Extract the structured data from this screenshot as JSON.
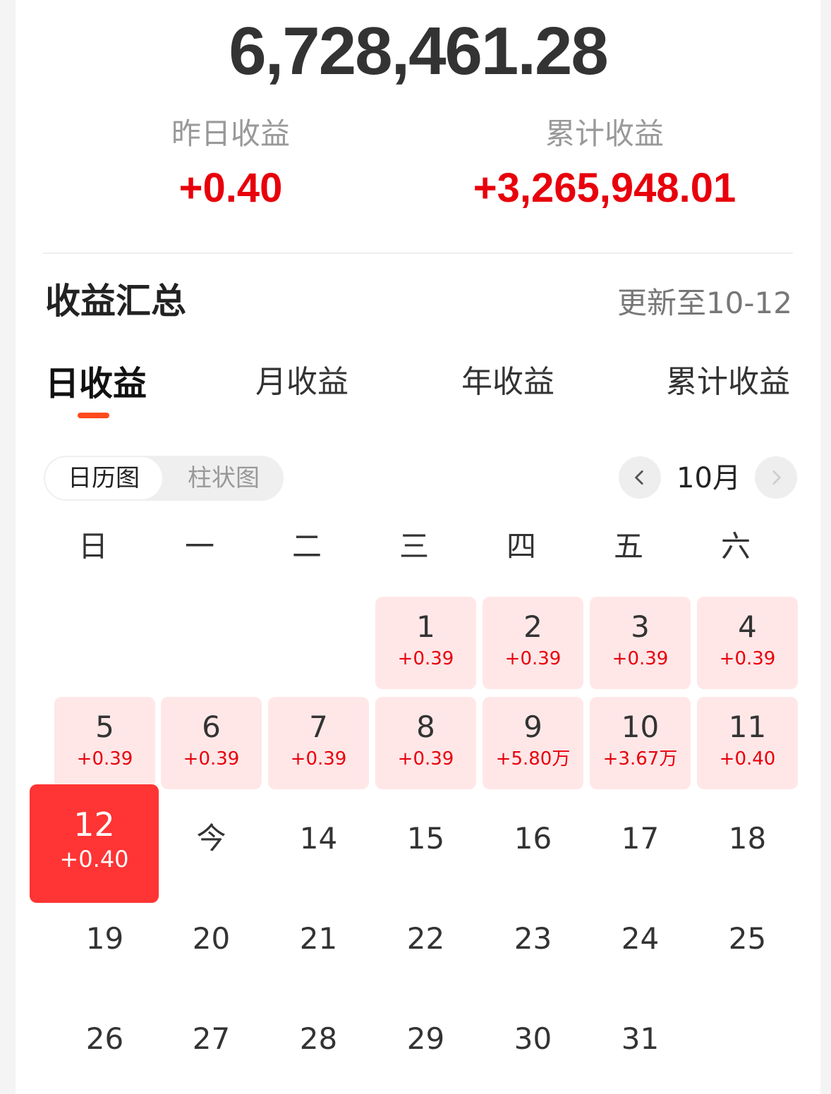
{
  "summary": {
    "total": "6,728,461.28",
    "yesterday_label": "昨日收益",
    "yesterday_value": "+0.40",
    "cumulative_label": "累计收益",
    "cumulative_value": "+3,265,948.01"
  },
  "section": {
    "title": "收益汇总",
    "update_text": "更新至10-12"
  },
  "tabs": [
    {
      "label": "日收益",
      "active": true
    },
    {
      "label": "月收益",
      "active": false
    },
    {
      "label": "年收益",
      "active": false
    },
    {
      "label": "累计收益",
      "active": false
    }
  ],
  "view_toggle": {
    "calendar_label": "日历图",
    "bar_label": "柱状图",
    "selected": "日历图"
  },
  "month_nav": {
    "month_label": "10月",
    "prev_icon": "chevron-left-icon",
    "next_icon": "chevron-right-icon"
  },
  "weekdays": [
    "日",
    "一",
    "二",
    "三",
    "四",
    "五",
    "六"
  ],
  "days": [
    {
      "label": "1",
      "earning": "+0.39"
    },
    {
      "label": "2",
      "earning": "+0.39"
    },
    {
      "label": "3",
      "earning": "+0.39"
    },
    {
      "label": "4",
      "earning": "+0.39"
    },
    {
      "label": "5",
      "earning": "+0.39"
    },
    {
      "label": "6",
      "earning": "+0.39"
    },
    {
      "label": "7",
      "earning": "+0.39"
    },
    {
      "label": "8",
      "earning": "+0.39"
    },
    {
      "label": "9",
      "earning": "+5.80万"
    },
    {
      "label": "10",
      "earning": "+3.67万"
    },
    {
      "label": "11",
      "earning": "+0.40"
    },
    {
      "label": "12",
      "earning": "+0.40",
      "selected": true
    },
    {
      "label": "今"
    },
    {
      "label": "14"
    },
    {
      "label": "15"
    },
    {
      "label": "16"
    },
    {
      "label": "17"
    },
    {
      "label": "18"
    },
    {
      "label": "19"
    },
    {
      "label": "20"
    },
    {
      "label": "21"
    },
    {
      "label": "22"
    },
    {
      "label": "23"
    },
    {
      "label": "24"
    },
    {
      "label": "25"
    },
    {
      "label": "26"
    },
    {
      "label": "27"
    },
    {
      "label": "28"
    },
    {
      "label": "29"
    },
    {
      "label": "30"
    },
    {
      "label": "31"
    }
  ],
  "colors": {
    "earning_red": "#e8000b",
    "selected_bg": "#ff3434",
    "earning_cell_bg": "#ffe7e8",
    "tab_indicator": "#ff4a1c"
  }
}
